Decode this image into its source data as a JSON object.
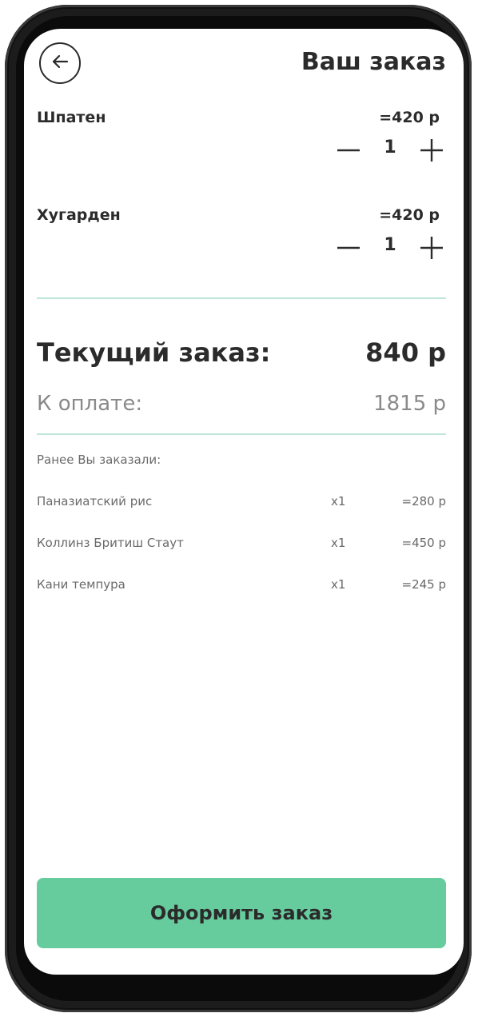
{
  "header": {
    "title": "Ваш заказ",
    "back_icon": "arrow-left-icon"
  },
  "cart": {
    "items": [
      {
        "name": "Шпатен",
        "price": "=420 р",
        "quantity": "1"
      },
      {
        "name": "Хугарден",
        "price": "=420 р",
        "quantity": "1"
      }
    ]
  },
  "totals": {
    "current_label": "Текущий заказ:",
    "current_value": "840 р",
    "pay_label": "К оплате:",
    "pay_value": "1815 р"
  },
  "previous": {
    "heading": "Ранее Вы заказали:",
    "items": [
      {
        "name": "Паназиатский рис",
        "qty": "x1",
        "price": "=280 р"
      },
      {
        "name": "Коллинз Бритиш Стаут",
        "qty": "x1",
        "price": "=450 р"
      },
      {
        "name": "Кани темпура",
        "qty": "x1",
        "price": "=245 р"
      }
    ]
  },
  "checkout": {
    "label": "Оформить заказ"
  },
  "colors": {
    "accent": "#66cc9e",
    "divider": "#bfe6d6",
    "text": "#2b2b2b",
    "muted": "#8a8a8a"
  }
}
